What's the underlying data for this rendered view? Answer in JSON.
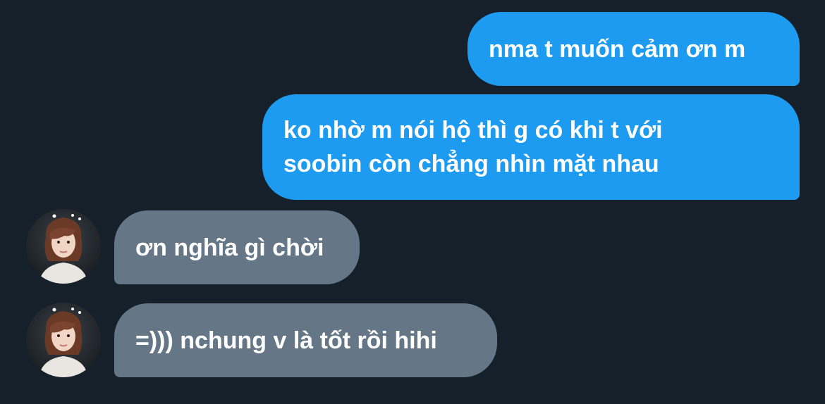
{
  "colors": {
    "background": "#16202a",
    "sent_bubble": "#1d9bf0",
    "received_bubble": "#657786",
    "text": "#ffffff"
  },
  "messages": [
    {
      "direction": "sent",
      "text": "nma t muốn cảm ơn m"
    },
    {
      "direction": "sent",
      "text": "ko nhờ m nói hộ thì g có khi t với\nsoobin còn chẳng nhìn mặt nhau"
    },
    {
      "direction": "received",
      "text": "ơn nghĩa gì chời",
      "avatar": "contact-avatar"
    },
    {
      "direction": "received",
      "text": "=))) nchung v là tốt rồi hihi",
      "avatar": "contact-avatar"
    }
  ]
}
